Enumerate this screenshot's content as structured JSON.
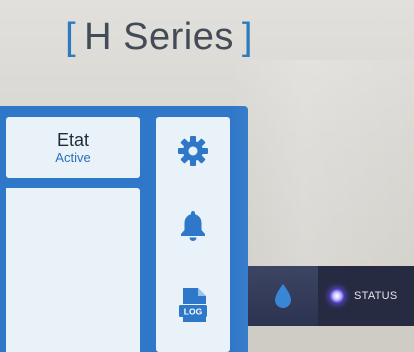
{
  "brand": {
    "bracket_open": "[",
    "name": "H Series",
    "bracket_close": "]"
  },
  "status_card": {
    "title": "Etat",
    "value": "Active"
  },
  "sidebar": {
    "items": [
      {
        "icon": "gear-icon"
      },
      {
        "icon": "bell-icon"
      },
      {
        "icon": "log-file-icon",
        "label": "LOG"
      }
    ]
  },
  "hardware": {
    "status_label": "STATUS",
    "drop_icon": "water-drop-icon"
  },
  "colors": {
    "accent": "#2f77c8",
    "panel": "#e8f2f8",
    "led": "#5a44e0"
  }
}
